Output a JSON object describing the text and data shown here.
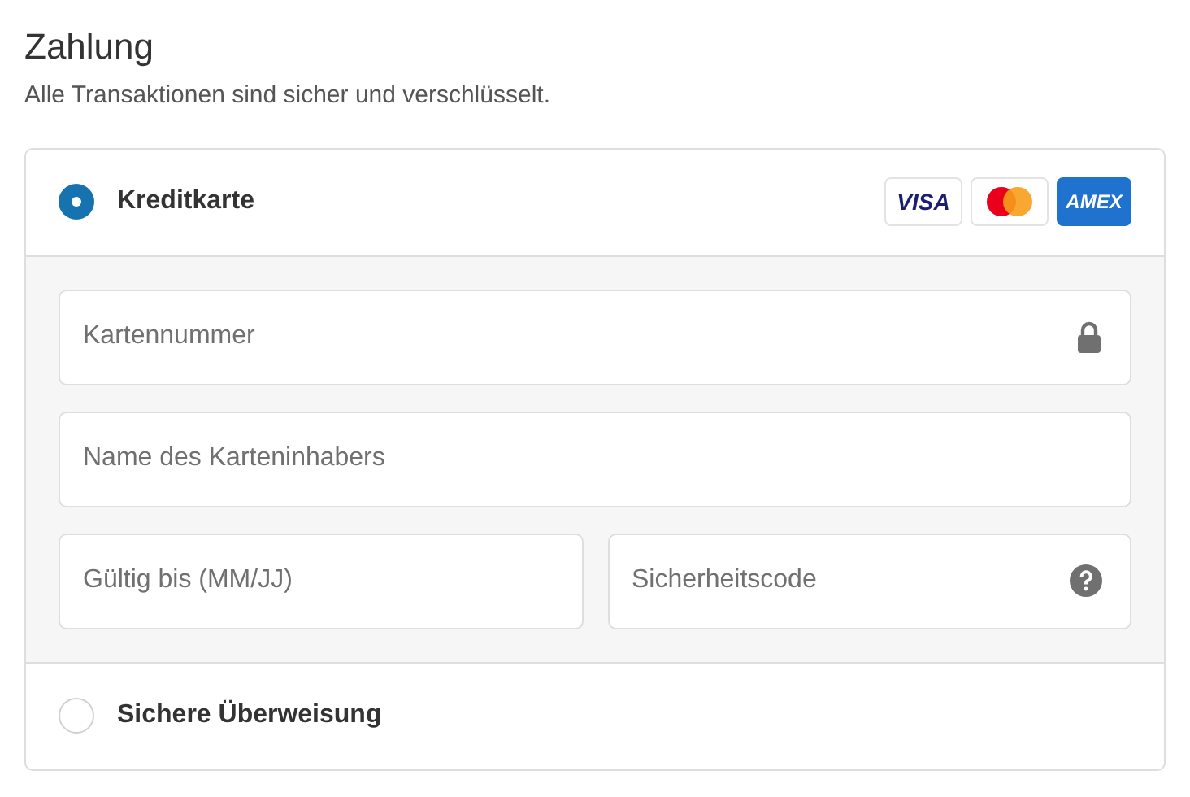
{
  "title": "Zahlung",
  "subtitle": "Alle Transaktionen sind sicher und verschlüsselt.",
  "options": [
    {
      "label": "Kreditkarte",
      "selected": true,
      "card_logos": [
        {
          "kind": "visa",
          "text": "VISA"
        },
        {
          "kind": "mastercard"
        },
        {
          "kind": "amex",
          "text": "AMEX"
        }
      ],
      "field_rows": [
        [
          {
            "placeholder": "Kartennummer",
            "kind": "lock"
          }
        ],
        [
          {
            "placeholder": "Name des Karteninhabers",
            "kind": "plain"
          }
        ],
        [
          {
            "placeholder": "Gültig bis (MM/JJ)",
            "kind": "plain"
          },
          {
            "placeholder": "Sicherheitscode",
            "kind": "help"
          }
        ]
      ]
    },
    {
      "label": "Sichere Überweisung",
      "selected": false
    }
  ]
}
